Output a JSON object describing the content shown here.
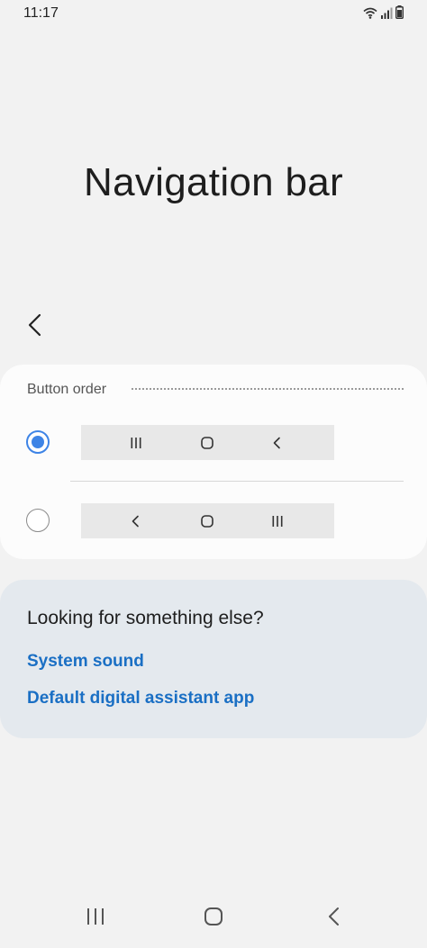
{
  "status_bar": {
    "time": "11:17",
    "icons": [
      "wifi-icon",
      "signal-icon",
      "battery-icon"
    ]
  },
  "page": {
    "title": "Navigation bar"
  },
  "button_order": {
    "label": "Button order",
    "options": [
      {
        "selected": true,
        "buttons": [
          "recents-icon",
          "home-icon",
          "back-icon"
        ]
      },
      {
        "selected": false,
        "buttons": [
          "back-icon",
          "home-icon",
          "recents-icon"
        ]
      }
    ]
  },
  "suggestions": {
    "title": "Looking for something else?",
    "links": [
      "System sound",
      "Default digital assistant app"
    ]
  },
  "nav_bar": {
    "buttons": [
      "recents-icon",
      "home-icon",
      "back-icon"
    ]
  },
  "colors": {
    "accent": "#3e84e6",
    "link": "#1a6fc4",
    "background": "#f2f2f2",
    "card": "#fcfcfc",
    "suggest_card": "#e4e9ee"
  }
}
